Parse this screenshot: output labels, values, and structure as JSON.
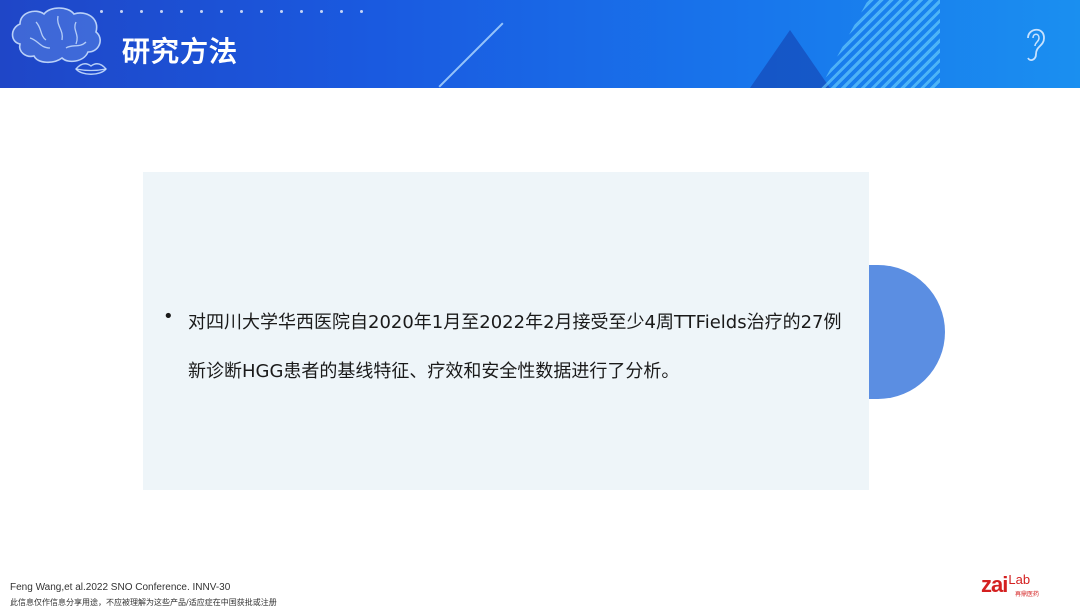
{
  "header": {
    "title": "研究方法",
    "icons": [
      "brain-icon",
      "lips-icon",
      "ear-icon"
    ],
    "colors": {
      "gradient_start": "#1f46c7",
      "gradient_end": "#1a8ff0"
    }
  },
  "content": {
    "bullet_text": "对四川大学华西医院自2020年1月至2022年2月接受至少4周TTFields治疗的27例新诊断HGG患者的基线特征、疗效和安全性数据进行了分析。",
    "box_color": "#eef5f9",
    "accent_color": "#5b8ee2"
  },
  "footer": {
    "reference": "Feng Wang,et al.2022 SNO Conference. INNV-30",
    "disclaimer": "此信息仅作信息分享用途，不应被理解为这些产品/适应症在中国获批或注册",
    "logo": {
      "main": "zai",
      "lab": "Lab",
      "sub": "再鼎医药"
    }
  }
}
